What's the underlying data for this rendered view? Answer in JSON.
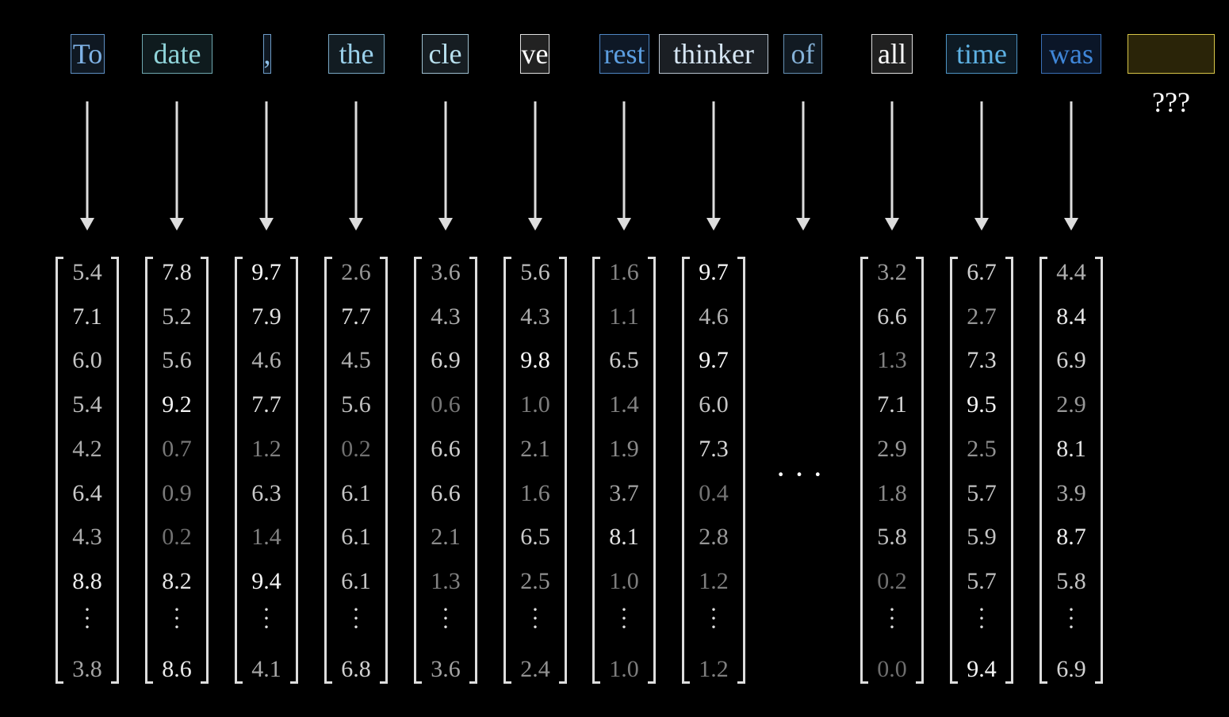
{
  "tokens": [
    {
      "text": "To",
      "color": "#7fb2e6",
      "border": "#5e8fc4",
      "bg": "#0f1822"
    },
    {
      "text": "date",
      "color": "#8fd3d8",
      "border": "#6fa9b0",
      "bg": "#0f1b1e"
    },
    {
      "text": ",",
      "color": "#8fc0e8",
      "border": "#6d9cc8",
      "bg": "#0f1822"
    },
    {
      "text": "the",
      "color": "#9ad0ea",
      "border": "#79a8c4",
      "bg": "#121c22"
    },
    {
      "text": "cle",
      "color": "#b8e0ee",
      "border": "#9fc0d0",
      "bg": "#161d22"
    },
    {
      "text": "ve",
      "color": "#ffffff",
      "border": "#e0e0e0",
      "bg": "#222222"
    },
    {
      "text": "rest",
      "color": "#5c9ee0",
      "border": "#4f86c4",
      "bg": "#0e1826"
    },
    {
      "text": "thinker",
      "color": "#d6e6f4",
      "border": "#b8c4d0",
      "bg": "#1b1f24"
    },
    {
      "text": "of",
      "color": "#85b2d8",
      "border": "#6690b4",
      "bg": "#111a22"
    },
    {
      "text": "all",
      "color": "#ffffff",
      "border": "#e0e0e0",
      "bg": "#202020"
    },
    {
      "text": "time",
      "color": "#5eb2e4",
      "border": "#4d94c4",
      "bg": "#0d1a24"
    },
    {
      "text": "was",
      "color": "#3f86d8",
      "border": "#3a70b8",
      "bg": "#0b1628"
    },
    {
      "text": "",
      "color": "#ffffff",
      "border": "#d8c648",
      "bg": "#2a2408"
    }
  ],
  "unknown_label": "???",
  "ellipsis": "···",
  "vectors": [
    {
      "token": "To",
      "values": [
        "5.4",
        "7.1",
        "6.0",
        "5.4",
        "4.2",
        "6.4",
        "4.3",
        "8.8"
      ],
      "last": "3.8"
    },
    {
      "token": "date",
      "values": [
        "7.8",
        "5.2",
        "5.6",
        "9.2",
        "0.7",
        "0.9",
        "0.2",
        "8.2"
      ],
      "last": "8.6"
    },
    {
      "token": ",",
      "values": [
        "9.7",
        "7.9",
        "4.6",
        "7.7",
        "1.2",
        "6.3",
        "1.4",
        "9.4"
      ],
      "last": "4.1"
    },
    {
      "token": "the",
      "values": [
        "2.6",
        "7.7",
        "4.5",
        "5.6",
        "0.2",
        "6.1",
        "6.1",
        "6.1"
      ],
      "last": "6.8"
    },
    {
      "token": "cle",
      "values": [
        "3.6",
        "4.3",
        "6.9",
        "0.6",
        "6.6",
        "6.6",
        "2.1",
        "1.3"
      ],
      "last": "3.6"
    },
    {
      "token": "ve",
      "values": [
        "5.6",
        "4.3",
        "9.8",
        "1.0",
        "2.1",
        "1.6",
        "6.5",
        "2.5"
      ],
      "last": "2.4"
    },
    {
      "token": "rest",
      "values": [
        "1.6",
        "1.1",
        "6.5",
        "1.4",
        "1.9",
        "3.7",
        "8.1",
        "1.0"
      ],
      "last": "1.0"
    },
    {
      "token": "thinker",
      "values": [
        "9.7",
        "4.6",
        "9.7",
        "6.0",
        "7.3",
        "0.4",
        "2.8",
        "1.2"
      ],
      "last": "1.2"
    },
    {
      "token": "all",
      "values": [
        "3.2",
        "6.6",
        "1.3",
        "7.1",
        "2.9",
        "1.8",
        "5.8",
        "0.2"
      ],
      "last": "0.0"
    },
    {
      "token": "time",
      "values": [
        "6.7",
        "2.7",
        "7.3",
        "9.5",
        "2.5",
        "5.7",
        "5.9",
        "5.7"
      ],
      "last": "9.4"
    },
    {
      "token": "was",
      "values": [
        "4.4",
        "8.4",
        "6.9",
        "2.9",
        "8.1",
        "3.9",
        "8.7",
        "5.8"
      ],
      "last": "6.9"
    }
  ]
}
